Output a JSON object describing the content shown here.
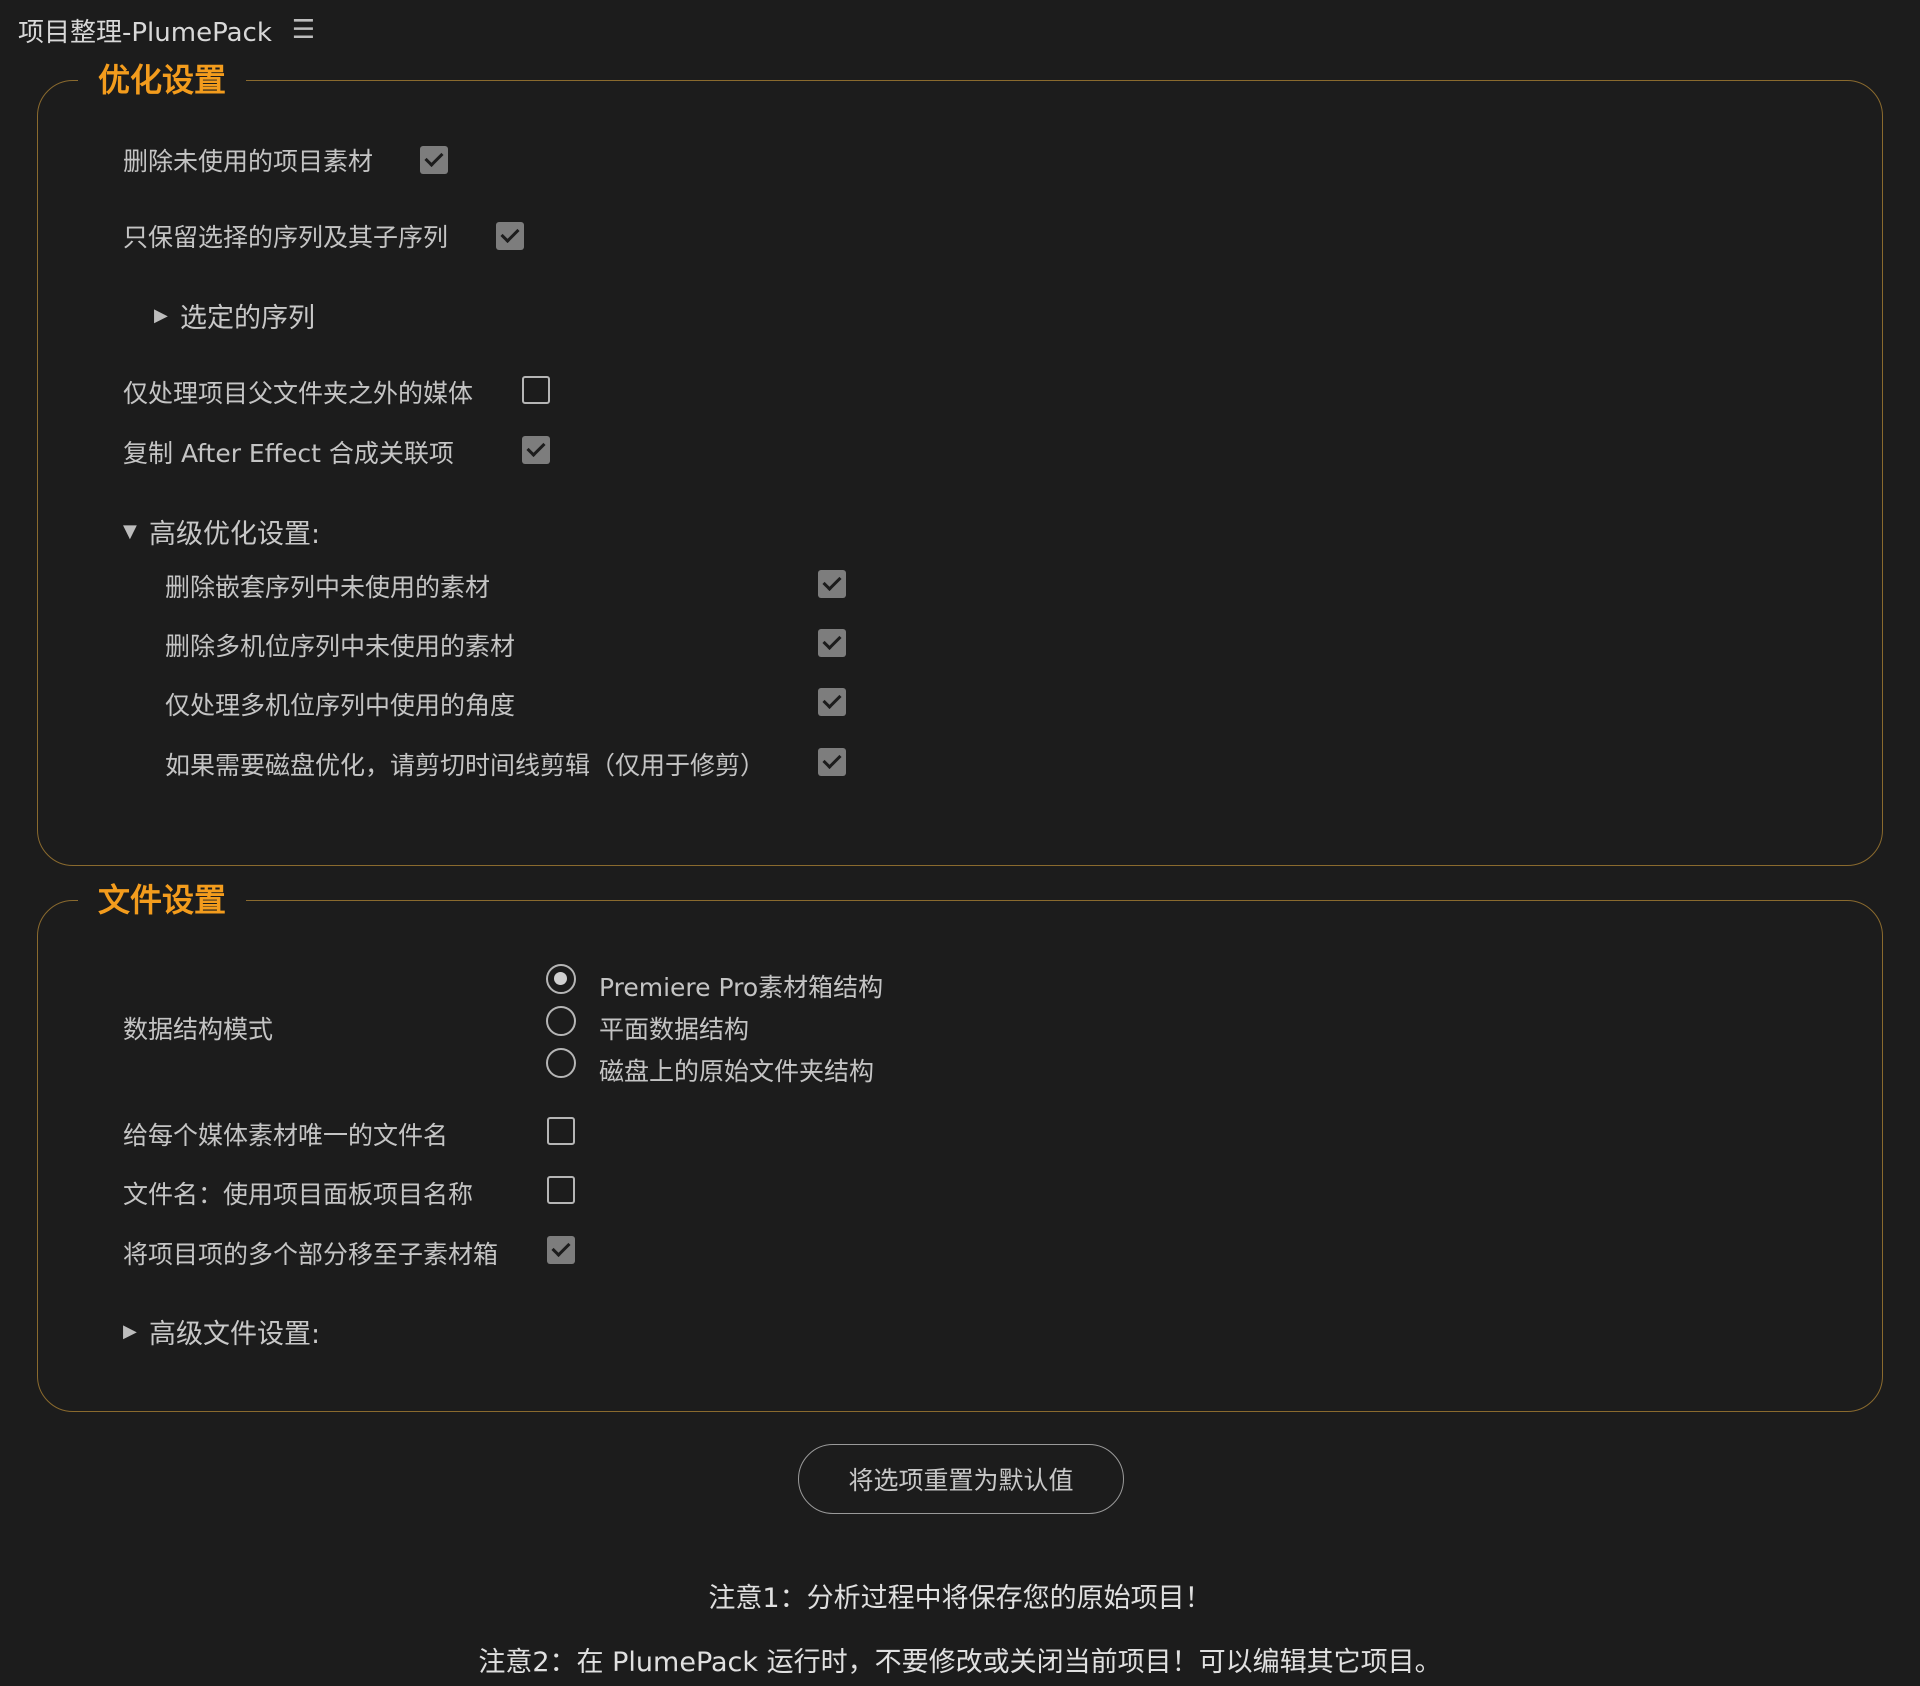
{
  "panel": {
    "title": "项目整理-PlumePack",
    "menu_icon": "hamburger-menu-icon"
  },
  "optimize": {
    "legend": "优化设置",
    "delete_unused": {
      "label": "删除未使用的项目素材",
      "checked": true
    },
    "keep_selected_sequences": {
      "label": "只保留选择的序列及其子序列",
      "checked": true
    },
    "selected_sequences": {
      "label": "选定的序列",
      "expanded": false
    },
    "process_outside_parent": {
      "label": "仅处理项目父文件夹之外的媒体",
      "checked": false
    },
    "copy_ae_links": {
      "label": "复制 After Effect 合成关联项",
      "checked": true
    },
    "advanced": {
      "label": "高级优化设置:",
      "expanded": true,
      "items": [
        {
          "label": "删除嵌套序列中未使用的素材",
          "checked": true
        },
        {
          "label": "删除多机位序列中未使用的素材",
          "checked": true
        },
        {
          "label": "仅处理多机位序列中使用的角度",
          "checked": true
        },
        {
          "label": "如果需要磁盘优化，请剪切时间线剪辑（仅用于修剪）",
          "checked": true
        }
      ]
    }
  },
  "file": {
    "legend": "文件设置",
    "structure_mode": {
      "label": "数据结构模式",
      "options": [
        {
          "label": "Premiere Pro素材箱结构",
          "selected": true
        },
        {
          "label": "平面数据结构",
          "selected": false
        },
        {
          "label": "磁盘上的原始文件夹结构",
          "selected": false
        }
      ]
    },
    "unique_filenames": {
      "label": "给每个媒体素材唯一的文件名",
      "checked": false
    },
    "use_panel_names": {
      "label": "文件名：使用项目面板项目名称",
      "checked": false
    },
    "move_subclips": {
      "label": "将项目项的多个部分移至子素材箱",
      "checked": true
    },
    "advanced": {
      "label": "高级文件设置:",
      "expanded": false
    }
  },
  "reset_button": {
    "label": "将选项重置为默认值"
  },
  "notes": {
    "note1": "注意1：分析过程中将保存您的原始项目！",
    "note2": "注意2：在 PlumePack 运行时，不要修改或关闭当前项目！可以编辑其它项目。"
  },
  "colors": {
    "accent": "#f39c1d",
    "border": "#8a6a2e",
    "background": "#1c1c1c"
  }
}
